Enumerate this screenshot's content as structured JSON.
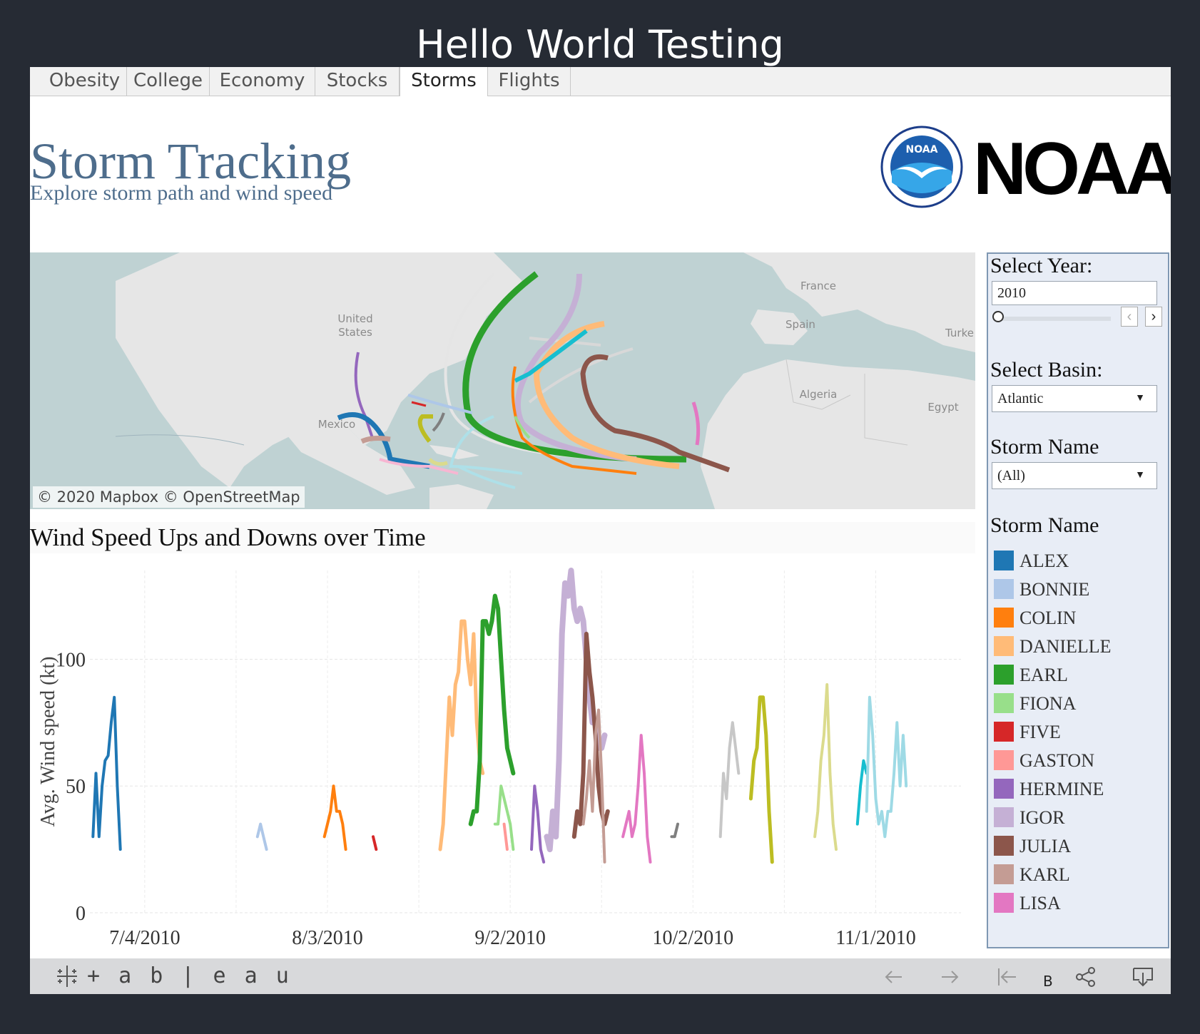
{
  "window": {
    "title": "Hello World Testing"
  },
  "tabs": [
    {
      "label": "Obesity",
      "active": false
    },
    {
      "label": "College",
      "active": false
    },
    {
      "label": "Economy",
      "active": false
    },
    {
      "label": "Stocks",
      "active": false
    },
    {
      "label": "Storms",
      "active": true
    },
    {
      "label": "Flights",
      "active": false
    }
  ],
  "dashboard": {
    "title": "Storm Tracking",
    "subtitle": "Explore storm path and wind speed",
    "logo_text": "NOAA",
    "logo_badge": "NOAA",
    "logo_seal_text": "NATIONAL OCEANIC AND ATMOSPHERIC ADMINISTRATION · U.S. DEPARTMENT OF COMMERCE"
  },
  "map": {
    "attribution": "© 2020 Mapbox  © OpenStreetMap",
    "labels": {
      "united_states": "United States",
      "mexico": "Mexico",
      "france": "France",
      "spain": "Spain",
      "turkey": "Turke",
      "algeria": "Algeria",
      "egypt": "Egypt"
    }
  },
  "chart": {
    "title": "Wind Speed Ups and Downs over Time"
  },
  "chart_data": {
    "type": "line",
    "title": "Wind Speed Ups and Downs over Time",
    "ylabel": "Avg. Wind speed (kt)",
    "xlabel": "",
    "ylim": [
      0,
      135
    ],
    "yticks": [
      0,
      50,
      100
    ],
    "xlim": [
      "2010-06-25",
      "2010-11-15"
    ],
    "xticks": [
      "2010-07-04",
      "2010-08-03",
      "2010-09-02",
      "2010-10-02",
      "2010-11-01"
    ],
    "xtick_labels": [
      "7/4/2010",
      "8/3/2010",
      "9/2/2010",
      "10/2/2010",
      "11/1/2010"
    ],
    "grid": true,
    "series": [
      {
        "name": "ALEX",
        "color": "#1f77b4",
        "width": 4,
        "points": [
          [
            "2010-06-25T12",
            30
          ],
          [
            "2010-06-26T00",
            55
          ],
          [
            "2010-06-26T12",
            30
          ],
          [
            "2010-06-27T00",
            50
          ],
          [
            "2010-06-27T12",
            60
          ],
          [
            "2010-06-28T00",
            62
          ],
          [
            "2010-06-28T12",
            75
          ],
          [
            "2010-06-29T00",
            85
          ],
          [
            "2010-06-29T12",
            50
          ],
          [
            "2010-06-30T00",
            25
          ]
        ]
      },
      {
        "name": "BONNIE",
        "color": "#aec7e8",
        "width": 4,
        "points": [
          [
            "2010-07-22T12",
            30
          ],
          [
            "2010-07-23T00",
            35
          ],
          [
            "2010-07-23T12",
            30
          ],
          [
            "2010-07-24T00",
            25
          ]
        ]
      },
      {
        "name": "COLIN",
        "color": "#ff7f0e",
        "width": 4,
        "points": [
          [
            "2010-08-02T12",
            30
          ],
          [
            "2010-08-03T00",
            35
          ],
          [
            "2010-08-03T12",
            40
          ],
          [
            "2010-08-04T00",
            50
          ],
          [
            "2010-08-04T12",
            40
          ],
          [
            "2010-08-05T00",
            40
          ],
          [
            "2010-08-05T12",
            35
          ],
          [
            "2010-08-06T00",
            25
          ]
        ]
      },
      {
        "name": "DANIELLE",
        "color": "#ffbb78",
        "width": 5,
        "points": [
          [
            "2010-08-21T12",
            25
          ],
          [
            "2010-08-22T00",
            35
          ],
          [
            "2010-08-22T12",
            60
          ],
          [
            "2010-08-23T00",
            85
          ],
          [
            "2010-08-23T12",
            70
          ],
          [
            "2010-08-24T00",
            90
          ],
          [
            "2010-08-24T12",
            95
          ],
          [
            "2010-08-25T00",
            115
          ],
          [
            "2010-08-25T12",
            115
          ],
          [
            "2010-08-26T00",
            100
          ],
          [
            "2010-08-26T12",
            90
          ],
          [
            "2010-08-27T00",
            110
          ],
          [
            "2010-08-27T12",
            75
          ],
          [
            "2010-08-28T00",
            60
          ],
          [
            "2010-08-28T12",
            55
          ]
        ]
      },
      {
        "name": "EARL",
        "color": "#2ca02c",
        "width": 6,
        "points": [
          [
            "2010-08-26T12",
            35
          ],
          [
            "2010-08-27T00",
            40
          ],
          [
            "2010-08-27T12",
            40
          ],
          [
            "2010-08-28T00",
            60
          ],
          [
            "2010-08-28T12",
            115
          ],
          [
            "2010-08-29T00",
            115
          ],
          [
            "2010-08-29T12",
            110
          ],
          [
            "2010-08-30T00",
            115
          ],
          [
            "2010-08-30T12",
            125
          ],
          [
            "2010-08-31T00",
            120
          ],
          [
            "2010-08-31T12",
            100
          ],
          [
            "2010-09-01T00",
            80
          ],
          [
            "2010-09-01T12",
            65
          ],
          [
            "2010-09-02T00",
            60
          ],
          [
            "2010-09-02T12",
            55
          ]
        ]
      },
      {
        "name": "FIONA",
        "color": "#98df8a",
        "width": 4,
        "points": [
          [
            "2010-08-30T12",
            35
          ],
          [
            "2010-08-31T00",
            35
          ],
          [
            "2010-08-31T12",
            50
          ],
          [
            "2010-09-01T00",
            45
          ],
          [
            "2010-09-01T12",
            40
          ],
          [
            "2010-09-02T00",
            35
          ],
          [
            "2010-09-02T12",
            25
          ]
        ]
      },
      {
        "name": "FIVE",
        "color": "#d62728",
        "width": 4,
        "points": [
          [
            "2010-08-10T12",
            30
          ],
          [
            "2010-08-11T00",
            25
          ]
        ]
      },
      {
        "name": "GASTON",
        "color": "#ff9896",
        "width": 4,
        "points": [
          [
            "2010-09-01T00",
            35
          ],
          [
            "2010-09-01T12",
            25
          ]
        ]
      },
      {
        "name": "HERMINE",
        "color": "#9467bd",
        "width": 4,
        "points": [
          [
            "2010-09-05T12",
            25
          ],
          [
            "2010-09-06T00",
            50
          ],
          [
            "2010-09-06T12",
            40
          ],
          [
            "2010-09-07T00",
            25
          ],
          [
            "2010-09-07T12",
            20
          ]
        ]
      },
      {
        "name": "IGOR",
        "color": "#c5b0d5",
        "width": 8,
        "points": [
          [
            "2010-09-08T00",
            30
          ],
          [
            "2010-09-08T12",
            25
          ],
          [
            "2010-09-09T00",
            40
          ],
          [
            "2010-09-09T12",
            30
          ],
          [
            "2010-09-10T00",
            60
          ],
          [
            "2010-09-10T12",
            110
          ],
          [
            "2010-09-11T00",
            130
          ],
          [
            "2010-09-11T12",
            125
          ],
          [
            "2010-09-12T00",
            135
          ],
          [
            "2010-09-12T12",
            120
          ],
          [
            "2010-09-13T00",
            115
          ],
          [
            "2010-09-13T12",
            120
          ],
          [
            "2010-09-14T00",
            115
          ],
          [
            "2010-09-14T12",
            100
          ],
          [
            "2010-09-15T00",
            85
          ],
          [
            "2010-09-15T12",
            75
          ],
          [
            "2010-09-16T00",
            75
          ],
          [
            "2010-09-16T12",
            65
          ],
          [
            "2010-09-17T00",
            65
          ],
          [
            "2010-09-17T12",
            70
          ]
        ]
      },
      {
        "name": "JULIA",
        "color": "#8c564b",
        "width": 6,
        "points": [
          [
            "2010-09-12T12",
            30
          ],
          [
            "2010-09-13T00",
            40
          ],
          [
            "2010-09-13T12",
            35
          ],
          [
            "2010-09-14T00",
            55
          ],
          [
            "2010-09-14T12",
            110
          ],
          [
            "2010-09-15T00",
            95
          ],
          [
            "2010-09-15T12",
            85
          ],
          [
            "2010-09-16T00",
            70
          ],
          [
            "2010-09-16T12",
            50
          ],
          [
            "2010-09-17T00",
            40
          ],
          [
            "2010-09-17T12",
            35
          ],
          [
            "2010-09-18T00",
            40
          ]
        ]
      },
      {
        "name": "KARL",
        "color": "#c49c94",
        "width": 4,
        "points": [
          [
            "2010-09-14T00",
            35
          ],
          [
            "2010-09-14T12",
            45
          ],
          [
            "2010-09-15T00",
            60
          ],
          [
            "2010-09-15T12",
            40
          ],
          [
            "2010-09-16T00",
            70
          ],
          [
            "2010-09-16T12",
            80
          ],
          [
            "2010-09-17T00",
            55
          ],
          [
            "2010-09-17T12",
            20
          ]
        ]
      },
      {
        "name": "LISA",
        "color": "#e377c2",
        "width": 4,
        "points": [
          [
            "2010-09-20T12",
            30
          ],
          [
            "2010-09-21T00",
            35
          ],
          [
            "2010-09-21T12",
            40
          ],
          [
            "2010-09-22T00",
            30
          ],
          [
            "2010-09-22T12",
            35
          ],
          [
            "2010-09-23T00",
            50
          ],
          [
            "2010-09-23T12",
            70
          ],
          [
            "2010-09-24T00",
            55
          ],
          [
            "2010-09-24T12",
            30
          ],
          [
            "2010-09-25T00",
            20
          ]
        ]
      },
      {
        "name": "",
        "color": "#7f7f7f",
        "width": 4,
        "points": [
          [
            "2010-09-28T12",
            30
          ],
          [
            "2010-09-29T00",
            30
          ],
          [
            "2010-09-29T12",
            35
          ]
        ]
      },
      {
        "name": "",
        "color": "#c7c7c7",
        "width": 4,
        "points": [
          [
            "2010-10-06T12",
            30
          ],
          [
            "2010-10-07T00",
            55
          ],
          [
            "2010-10-07T12",
            45
          ],
          [
            "2010-10-08T00",
            65
          ],
          [
            "2010-10-08T12",
            75
          ],
          [
            "2010-10-09T00",
            65
          ],
          [
            "2010-10-09T12",
            55
          ]
        ]
      },
      {
        "name": "",
        "color": "#bcbd22",
        "width": 5,
        "points": [
          [
            "2010-10-11T12",
            45
          ],
          [
            "2010-10-12T00",
            60
          ],
          [
            "2010-10-12T12",
            65
          ],
          [
            "2010-10-13T00",
            85
          ],
          [
            "2010-10-13T12",
            85
          ],
          [
            "2010-10-14T00",
            70
          ],
          [
            "2010-10-14T12",
            40
          ],
          [
            "2010-10-15T00",
            20
          ]
        ]
      },
      {
        "name": "",
        "color": "#dbdb8d",
        "width": 4,
        "points": [
          [
            "2010-10-22T00",
            30
          ],
          [
            "2010-10-22T12",
            40
          ],
          [
            "2010-10-23T00",
            60
          ],
          [
            "2010-10-23T12",
            70
          ],
          [
            "2010-10-24T00",
            90
          ],
          [
            "2010-10-24T12",
            55
          ],
          [
            "2010-10-25T00",
            35
          ],
          [
            "2010-10-25T12",
            25
          ]
        ]
      },
      {
        "name": "",
        "color": "#17becf",
        "width": 4,
        "points": [
          [
            "2010-10-29T00",
            35
          ],
          [
            "2010-10-29T12",
            50
          ],
          [
            "2010-10-30T00",
            60
          ],
          [
            "2010-10-30T12",
            55
          ]
        ]
      },
      {
        "name": "",
        "color": "#9edae5",
        "width": 4,
        "points": [
          [
            "2010-10-30T12",
            40
          ],
          [
            "2010-10-31T00",
            85
          ],
          [
            "2010-10-31T12",
            70
          ],
          [
            "2010-11-01T00",
            45
          ],
          [
            "2010-11-01T12",
            35
          ],
          [
            "2010-11-02T00",
            40
          ],
          [
            "2010-11-02T12",
            30
          ],
          [
            "2010-11-03T00",
            40
          ],
          [
            "2010-11-03T12",
            40
          ],
          [
            "2010-11-04T00",
            55
          ],
          [
            "2010-11-04T12",
            75
          ],
          [
            "2010-11-05T00",
            50
          ],
          [
            "2010-11-05T12",
            70
          ],
          [
            "2010-11-06T00",
            50
          ]
        ]
      }
    ]
  },
  "filters": {
    "year": {
      "label": "Select Year:",
      "value": "2010"
    },
    "basin": {
      "label": "Select Basin:",
      "value": "Atlantic"
    },
    "storm": {
      "label": "Storm Name",
      "value": "(All)"
    }
  },
  "legend": {
    "title": "Storm Name",
    "items": [
      {
        "label": "ALEX",
        "color": "#1f77b4"
      },
      {
        "label": "BONNIE",
        "color": "#aec7e8"
      },
      {
        "label": "COLIN",
        "color": "#ff7f0e"
      },
      {
        "label": "DANIELLE",
        "color": "#ffbb78"
      },
      {
        "label": "EARL",
        "color": "#2ca02c"
      },
      {
        "label": "FIONA",
        "color": "#98df8a"
      },
      {
        "label": "FIVE",
        "color": "#d62728"
      },
      {
        "label": "GASTON",
        "color": "#ff9896"
      },
      {
        "label": "HERMINE",
        "color": "#9467bd"
      },
      {
        "label": "IGOR",
        "color": "#c5b0d5"
      },
      {
        "label": "JULIA",
        "color": "#8c564b"
      },
      {
        "label": "KARL",
        "color": "#c49c94"
      },
      {
        "label": "LISA",
        "color": "#e377c2"
      }
    ]
  },
  "footer": {
    "brand": "+ a b | e a u",
    "label_b": "B",
    "icons": [
      "undo-icon",
      "redo-icon",
      "revert-icon",
      "share-icon",
      "download-icon"
    ]
  }
}
